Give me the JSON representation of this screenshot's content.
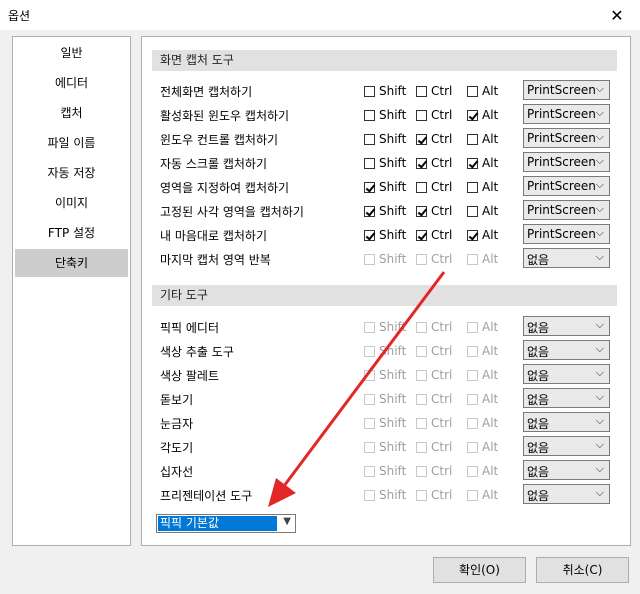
{
  "window": {
    "title": "옵션"
  },
  "icons": {
    "close": "close-icon",
    "dropdown": "chevron-down-icon",
    "annotation": "red-arrow-annotation"
  },
  "colors": {
    "selection": "#0078d7",
    "annotation_arrow": "#e32626",
    "section_header": "#e1e1e1"
  },
  "sidebar": {
    "items": [
      {
        "label": "일반",
        "selected": false
      },
      {
        "label": "에디터",
        "selected": false
      },
      {
        "label": "캡처",
        "selected": false
      },
      {
        "label": "파일 이름",
        "selected": false
      },
      {
        "label": "자동 저장",
        "selected": false
      },
      {
        "label": "이미지",
        "selected": false
      },
      {
        "label": "FTP 설정",
        "selected": false
      },
      {
        "label": "단축키",
        "selected": true
      }
    ]
  },
  "capture_tools": {
    "header": "화면 캡처 도구",
    "rows": [
      {
        "label": "전체화면 캡처하기",
        "shift": false,
        "ctrl": false,
        "alt": false,
        "key": "PrintScreen",
        "enabled": true
      },
      {
        "label": "활성화된 윈도우 캡처하기",
        "shift": false,
        "ctrl": false,
        "alt": true,
        "key": "PrintScreen",
        "enabled": true
      },
      {
        "label": "윈도우 컨트롤 캡처하기",
        "shift": false,
        "ctrl": true,
        "alt": false,
        "key": "PrintScreen",
        "enabled": true
      },
      {
        "label": "자동 스크롤 캡처하기",
        "shift": false,
        "ctrl": true,
        "alt": true,
        "key": "PrintScreen",
        "enabled": true
      },
      {
        "label": "영역을 지정하여 캡처하기",
        "shift": true,
        "ctrl": false,
        "alt": false,
        "key": "PrintScreen",
        "enabled": true
      },
      {
        "label": "고정된 사각 영역을 캡처하기",
        "shift": true,
        "ctrl": true,
        "alt": false,
        "key": "PrintScreen",
        "enabled": true
      },
      {
        "label": "내 마음대로 캡처하기",
        "shift": true,
        "ctrl": true,
        "alt": true,
        "key": "PrintScreen",
        "enabled": true
      },
      {
        "label": "마지막 캡처 영역 반복",
        "shift": false,
        "ctrl": false,
        "alt": false,
        "key": "없음",
        "enabled": false
      }
    ]
  },
  "other_tools": {
    "header": "기타 도구",
    "rows": [
      {
        "label": "픽픽 에디터",
        "shift": false,
        "ctrl": false,
        "alt": false,
        "key": "없음",
        "enabled": false
      },
      {
        "label": "색상 추출 도구",
        "shift": false,
        "ctrl": false,
        "alt": false,
        "key": "없음",
        "enabled": false
      },
      {
        "label": "색상 팔레트",
        "shift": false,
        "ctrl": false,
        "alt": false,
        "key": "없음",
        "enabled": false
      },
      {
        "label": "돋보기",
        "shift": false,
        "ctrl": false,
        "alt": false,
        "key": "없음",
        "enabled": false
      },
      {
        "label": "눈금자",
        "shift": false,
        "ctrl": false,
        "alt": false,
        "key": "없음",
        "enabled": false
      },
      {
        "label": "각도기",
        "shift": false,
        "ctrl": false,
        "alt": false,
        "key": "없음",
        "enabled": false
      },
      {
        "label": "십자선",
        "shift": false,
        "ctrl": false,
        "alt": false,
        "key": "없음",
        "enabled": false
      },
      {
        "label": "프리젠테이션 도구",
        "shift": false,
        "ctrl": false,
        "alt": false,
        "key": "없음",
        "enabled": false
      }
    ]
  },
  "modifiers": {
    "shift": "Shift",
    "ctrl": "Ctrl",
    "alt": "Alt"
  },
  "preset": {
    "value": "픽픽 기본값"
  },
  "buttons": {
    "ok": "확인(O)",
    "cancel": "취소(C)"
  }
}
